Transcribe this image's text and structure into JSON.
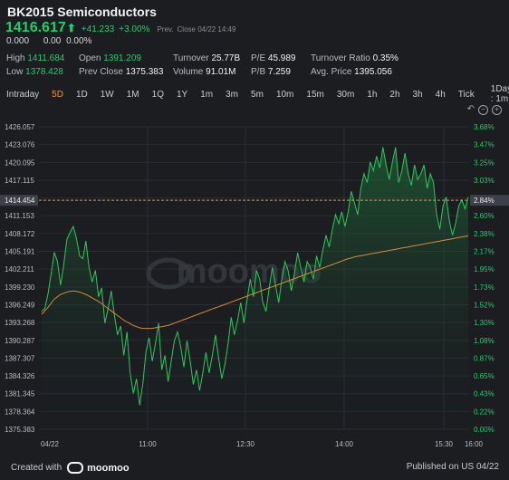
{
  "header": {
    "title": "BK2015 Semiconductors",
    "price": "1416.617",
    "arrow": "⬆",
    "change": "+41.233",
    "change_pct": "+3.00%",
    "prev_label": "Prev.",
    "close_label": "Close 04/22 14:49",
    "sub_values": [
      "0.000",
      "0.00",
      "0.00%"
    ]
  },
  "stats": {
    "col1": [
      {
        "label": "High",
        "value": "1411.684"
      },
      {
        "label": "Low",
        "value": "1378.428"
      }
    ],
    "col2": [
      {
        "label": "Open",
        "value": "1391.209"
      },
      {
        "label": "Prev Close",
        "value": "1375.383"
      }
    ],
    "col3": [
      {
        "label": "Turnover",
        "value": "25.77B"
      },
      {
        "label": "Volume",
        "value": "91.01M"
      }
    ],
    "col4": [
      {
        "label": "P/E",
        "value": "45.989"
      },
      {
        "label": "P/B",
        "value": "7.259"
      }
    ],
    "col5": [
      {
        "label": "Turnover Ratio",
        "value": "0.35%"
      },
      {
        "label": "Avg. Price",
        "value": "1395.056"
      }
    ]
  },
  "tabs": [
    "Intraday",
    "5D",
    "1D",
    "1W",
    "1M",
    "1Q",
    "1Y",
    "1m",
    "3m",
    "5m",
    "10m",
    "15m",
    "30m",
    "1h",
    "2h",
    "3h",
    "4h",
    "Tick",
    "1Day : 1m"
  ],
  "active_tab": "5D",
  "tool_icons": [
    "undo-icon",
    "zoom-out-icon",
    "zoom-in-icon"
  ],
  "colors": {
    "up": "#1fcf6b",
    "accent": "#f0973e",
    "line": "#2ec75d",
    "avg": "#d98a36",
    "bg": "#1b1d21"
  },
  "watermark": "moomoo",
  "chart_data": {
    "type": "line",
    "series": [
      {
        "values": [
          1395.5,
          1396.0,
          1398.5,
          1402.0,
          1405.6,
          1404.0,
          1400.0,
          1403.5,
          1407.8,
          1409.0,
          1410.0,
          1408.0,
          1405.0,
          1404.5,
          1407.5,
          1403.0,
          1400.5,
          1402.5,
          1398.0,
          1399.5,
          1393.5,
          1396.0,
          1399.0,
          1395.0,
          1391.5,
          1393.0,
          1388.0,
          1392.0,
          1385.0,
          1381.5,
          1384.0,
          1379.5,
          1383.0,
          1388.5,
          1391.0,
          1387.0,
          1390.0,
          1393.5,
          1385.5,
          1388.0,
          1383.5,
          1387.0,
          1390.5,
          1392.0,
          1389.5,
          1386.0,
          1390.5,
          1387.0,
          1383.0,
          1385.5,
          1382.0,
          1385.0,
          1388.5,
          1385.0,
          1388.0,
          1391.5,
          1387.5,
          1384.0,
          1386.5,
          1390.0,
          1394.5,
          1391.5,
          1394.0,
          1397.0,
          1393.5,
          1397.5,
          1401.0,
          1398.0,
          1402.5,
          1401.0,
          1397.0,
          1395.5,
          1399.5,
          1403.0,
          1400.0,
          1397.0,
          1401.0,
          1404.0,
          1402.5,
          1399.0,
          1402.0,
          1405.5,
          1403.0,
          1400.5,
          1404.0,
          1403.0,
          1401.0,
          1405.0,
          1403.0,
          1406.0,
          1408.5,
          1406.5,
          1409.5,
          1412.0,
          1410.5,
          1412.5,
          1410.0,
          1412.5,
          1416.0,
          1414.0,
          1412.0,
          1416.5,
          1419.0,
          1417.5,
          1421.0,
          1419.5,
          1422.0,
          1420.0,
          1423.5,
          1420.5,
          1418.0,
          1421.0,
          1423.5,
          1417.5,
          1419.5,
          1422.5,
          1419.0,
          1417.0,
          1420.5,
          1418.0,
          1419.0,
          1420.5,
          1416.5,
          1419.0,
          1417.5,
          1412.0,
          1409.5,
          1413.5,
          1415.0,
          1411.0,
          1408.5,
          1410.5,
          1413.5,
          1414.5,
          1413.0,
          1415.0
        ]
      },
      {
        "values": [
          1395.0,
          1395.6,
          1396.2,
          1396.9,
          1397.6,
          1398.0,
          1398.4,
          1398.6,
          1398.8,
          1398.9,
          1399.0,
          1398.9,
          1398.8,
          1398.6,
          1398.4,
          1398.1,
          1397.8,
          1397.5,
          1397.2,
          1396.8,
          1396.4,
          1396.0,
          1395.6,
          1395.2,
          1394.8,
          1394.4,
          1394.0,
          1393.7,
          1393.4,
          1393.1,
          1392.9,
          1392.7,
          1392.6,
          1392.6,
          1392.6,
          1392.6,
          1392.7,
          1392.8,
          1392.9,
          1393.0,
          1393.1,
          1393.3,
          1393.5,
          1393.7,
          1393.9,
          1394.1,
          1394.3,
          1394.5,
          1394.7,
          1394.9,
          1395.1,
          1395.3,
          1395.5,
          1395.7,
          1395.9,
          1396.1,
          1396.3,
          1396.5,
          1396.7,
          1396.9,
          1397.1,
          1397.3,
          1397.5,
          1397.7,
          1397.9,
          1398.1,
          1398.3,
          1398.5,
          1398.7,
          1398.9,
          1399.1,
          1399.3,
          1399.5,
          1399.7,
          1399.9,
          1400.1,
          1400.3,
          1400.5,
          1400.7,
          1400.9,
          1401.1,
          1401.3,
          1401.5,
          1401.7,
          1401.9,
          1402.1,
          1402.3,
          1402.5,
          1402.7,
          1402.9,
          1403.1,
          1403.3,
          1403.5,
          1403.7,
          1403.9,
          1404.1,
          1404.3,
          1404.5,
          1404.6,
          1404.8,
          1404.9,
          1405.0,
          1405.1,
          1405.2,
          1405.3,
          1405.4,
          1405.5,
          1405.6,
          1405.7,
          1405.8,
          1405.9,
          1406.0,
          1406.1,
          1406.2,
          1406.3,
          1406.4,
          1406.5,
          1406.6,
          1406.7,
          1406.8,
          1406.9,
          1407.0,
          1407.1,
          1407.2,
          1407.3,
          1407.4,
          1407.5,
          1407.6,
          1407.7,
          1407.8,
          1407.9,
          1408.0,
          1408.1,
          1408.2,
          1408.3,
          1408.4
        ]
      }
    ],
    "current_price": 1414.454,
    "ylim": [
      1375.383,
      1427.0
    ],
    "y_ticks": [
      "1426.057",
      "1423.076",
      "1420.095",
      "1417.115",
      "1414.454",
      "1411.153",
      "1408.172",
      "1405.191",
      "1402.211",
      "1399.230",
      "1396.249",
      "1393.268",
      "1390.287",
      "1387.307",
      "1384.326",
      "1381.345",
      "1378.364",
      "1375.383"
    ],
    "y_pct_ticks": [
      "3.68%",
      "3.47%",
      "3.25%",
      "3.03%",
      "2.84%",
      "2.60%",
      "2.38%",
      "2.17%",
      "1.95%",
      "1.73%",
      "1.52%",
      "1.30%",
      "1.08%",
      "0.87%",
      "0.65%",
      "0.43%",
      "0.22%",
      "0.00%"
    ],
    "x_ticks": [
      "04/22",
      "11:00",
      "12:30",
      "14:00",
      "15:30",
      "16:00"
    ],
    "grid": true
  },
  "footer": {
    "created_with": "Created with",
    "brand": "moomoo",
    "published": "Published on US 04/22"
  }
}
